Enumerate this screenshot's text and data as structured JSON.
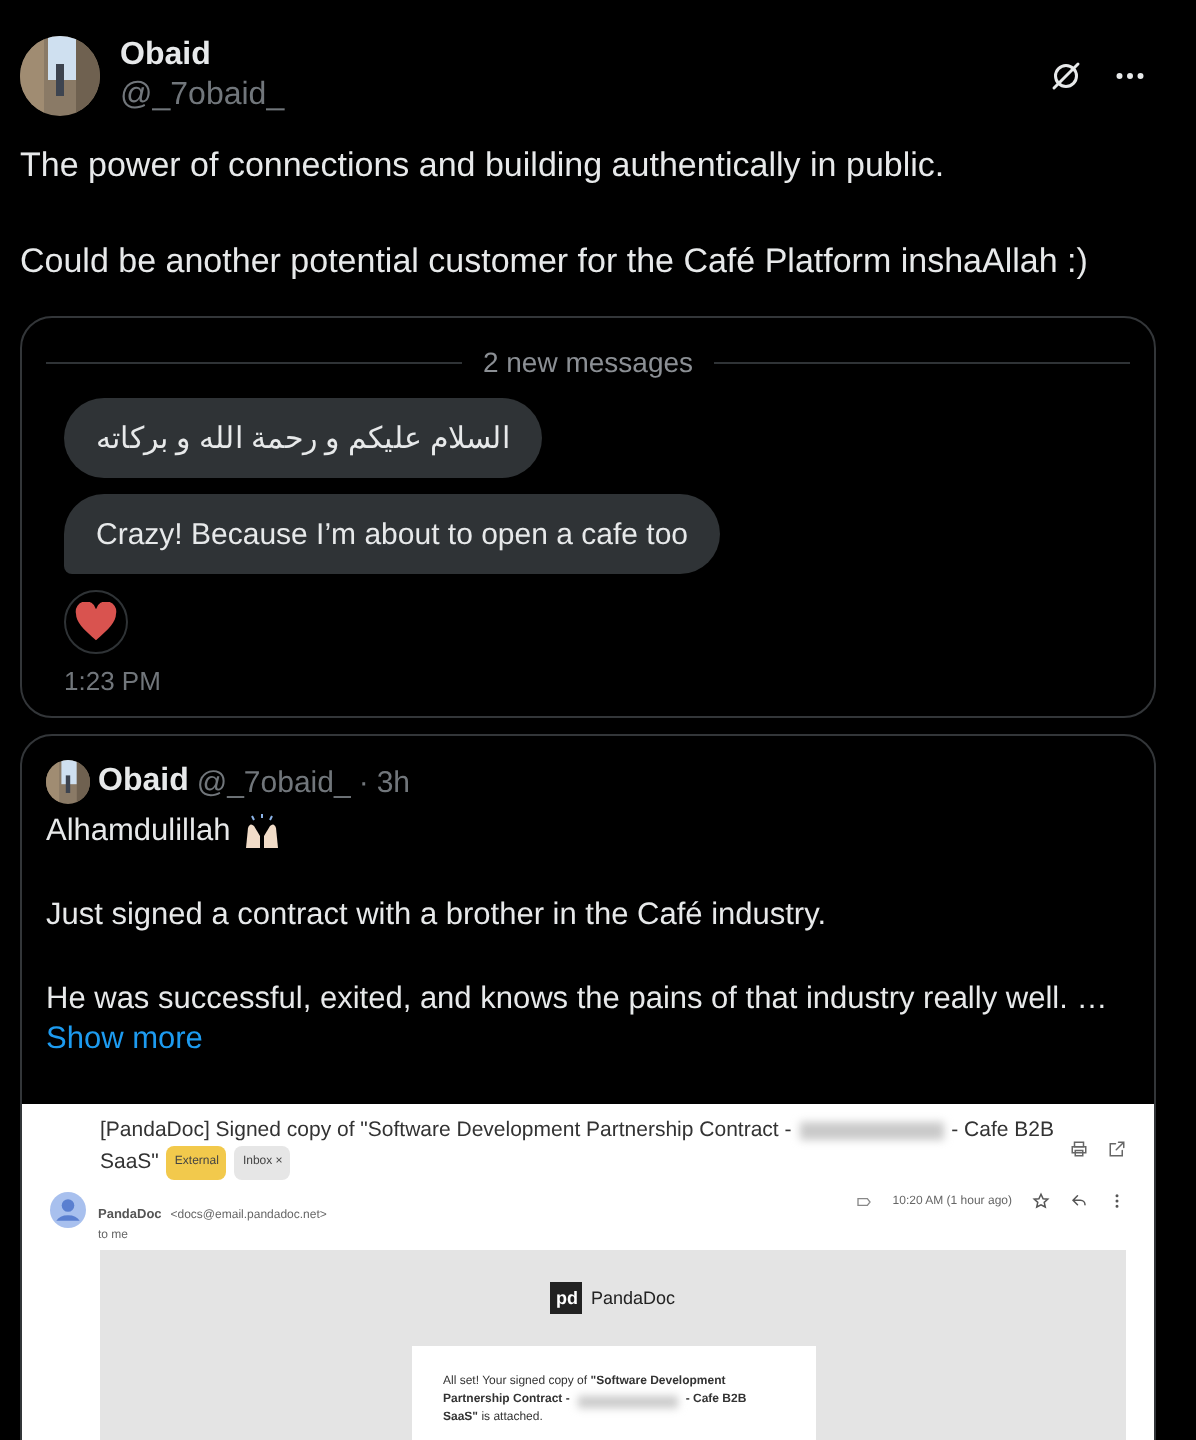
{
  "post": {
    "author": {
      "name": "Obaid",
      "handle": "@_7obaid_"
    },
    "paragraphs": [
      "The power of connections and building authentically in public.",
      "Could be another potential customer for the Café Platform inshaAllah :)"
    ]
  },
  "dm_card": {
    "divider": "2 new messages",
    "messages": [
      {
        "text": "السلام عليكم و رحمة الله و بركاته"
      },
      {
        "text": "Crazy! Because I’m about to open a cafe too"
      }
    ],
    "reaction": {
      "kind": "heart"
    },
    "time": "1:23 PM"
  },
  "quoted_post": {
    "name": "Obaid",
    "handle": "@_7obaid_",
    "separator": "·",
    "age": "3h",
    "paragraphs": [
      "Alhamdulillah",
      "Just signed a contract with a brother in the Café industry.",
      "He was successful, exited, and knows the pains of that industry really well.  …"
    ],
    "show_more": "Show more",
    "email": {
      "subject_line_1": "[PandaDoc] Signed copy of \"Software Development Partnership Contract -",
      "subject_line_1_end": "- Cafe B2B",
      "subject_line_2": "SaaS\"",
      "labels": [
        {
          "text": "External",
          "kind": "external"
        },
        {
          "text": "Inbox",
          "kind": "inbox",
          "remove": "×"
        }
      ],
      "sender": "PandaDoc",
      "sender_email": "<docs@email.pandadoc.net>",
      "recipient": "to me",
      "time": "10:20 AM (1 hour ago)",
      "logo_mark": "pd",
      "logo_text": "PandaDoc",
      "body_line_1": "All set! Your signed copy of **\"Software Development**",
      "body_line_2": "**Partnership Contract -**",
      "body_line_2_end": "**- Cafe B2B**",
      "body_line_3": "**SaaS\"** is attached."
    }
  }
}
